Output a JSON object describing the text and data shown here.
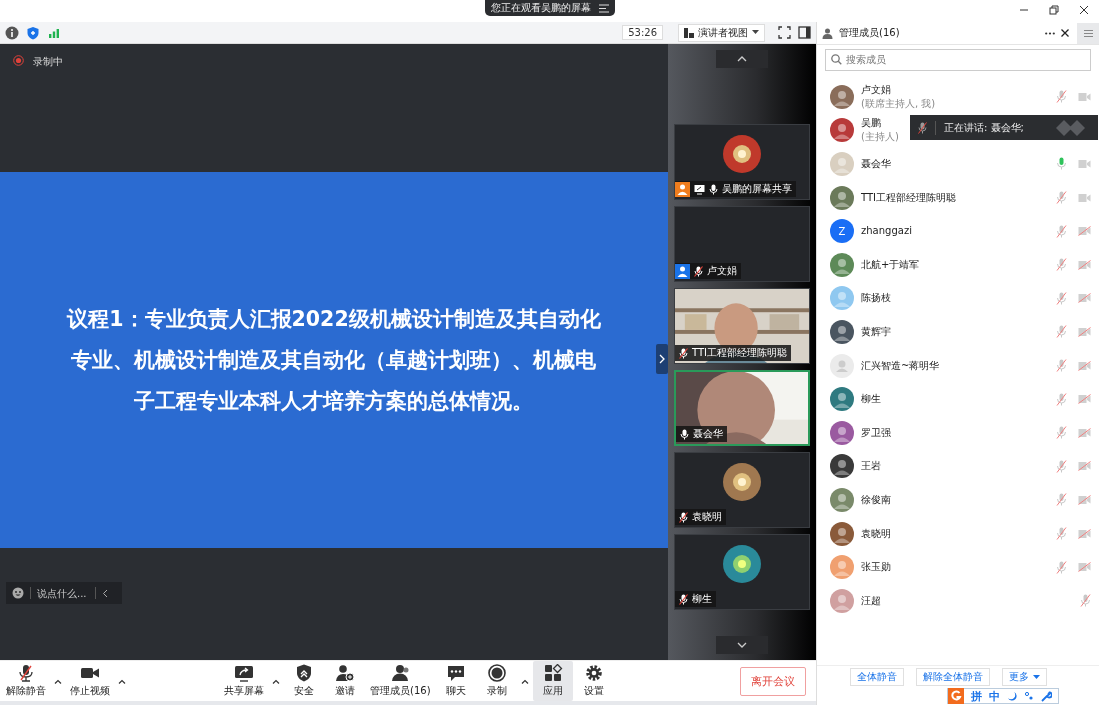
{
  "top_banner": {
    "text": "您正在观看吴鹏的屏幕"
  },
  "toolbar": {
    "timer": "53:26",
    "view_mode": "演讲者视图"
  },
  "recording": {
    "label": "录制中"
  },
  "slide": {
    "lines": [
      "议程1：专业负责人汇报2022级机械设计制造及其自动化",
      "专业、机械设计制造及其自动化（卓越计划班）、机械电",
      "子工程专业本科人才培养方案的总体情况。"
    ]
  },
  "chat_input": {
    "placeholder": "说点什么..."
  },
  "tiles": [
    {
      "name": "吴鹏的屏幕共享",
      "color": "#f07d1e",
      "sharing": true,
      "muted": false,
      "kind": "avatar",
      "speaking": false
    },
    {
      "name": "卢文娟",
      "color": "#1a73e8",
      "sharing": false,
      "muted": true,
      "kind": "empty",
      "speaking": false
    },
    {
      "name": "TTI工程部经理陈明聪",
      "sharing": false,
      "muted": true,
      "kind": "video",
      "speaking": false
    },
    {
      "name": "聂会华",
      "sharing": false,
      "muted": false,
      "kind": "video",
      "speaking": true
    },
    {
      "name": "袁晓明",
      "sharing": false,
      "muted": true,
      "kind": "avatar",
      "speaking": false
    },
    {
      "name": "柳生",
      "sharing": false,
      "muted": true,
      "kind": "avatar",
      "speaking": false
    }
  ],
  "bottom_toolbar": {
    "left_buttons": [
      {
        "kind": "mic",
        "label": "解除静音",
        "caret": true,
        "selected": false
      },
      {
        "kind": "camera",
        "label": "停止视频",
        "caret": true,
        "selected": false
      }
    ],
    "center_buttons": [
      {
        "kind": "share",
        "label": "共享屏幕",
        "caret": true,
        "selected": false
      },
      {
        "kind": "security",
        "label": "安全",
        "caret": false,
        "selected": false
      },
      {
        "kind": "invite",
        "label": "邀请",
        "caret": false,
        "selected": false
      },
      {
        "kind": "members",
        "label": "管理成员(16)",
        "caret": false,
        "selected": false
      },
      {
        "kind": "chat",
        "label": "聊天",
        "caret": false,
        "selected": false
      },
      {
        "kind": "record",
        "label": "录制",
        "caret": true,
        "selected": false
      },
      {
        "kind": "apps",
        "label": "应用",
        "caret": false,
        "selected": true
      },
      {
        "kind": "settings",
        "label": "设置",
        "caret": false,
        "selected": false
      }
    ],
    "leave": "离开会议"
  },
  "members_panel": {
    "title": "管理成员(16)",
    "search": {
      "placeholder": "搜索成员"
    },
    "members": [
      {
        "name": "卢文娟",
        "role": "(联席主持人, 我)",
        "mic_muted": true,
        "speaking": false,
        "camera_blocked": false
      },
      {
        "name": "吴鹏",
        "role": "(主持人)"
      },
      {
        "name": "聂会华",
        "mic_muted": false,
        "speaking": true,
        "camera_blocked": false
      },
      {
        "name": "TTI工程部经理陈明聪",
        "mic_muted": true,
        "speaking": false,
        "camera_blocked": false
      },
      {
        "name": "zhanggazi",
        "kind": "letter",
        "letter": "Z",
        "mic_muted": true,
        "speaking": false,
        "camera_blocked": true
      },
      {
        "name": "北航+于靖军",
        "mic_muted": true,
        "speaking": false,
        "camera_blocked": true
      },
      {
        "name": "陈扬枝",
        "mic_muted": true,
        "speaking": false,
        "camera_blocked": true
      },
      {
        "name": "黄辉宇",
        "mic_muted": true,
        "speaking": false,
        "camera_blocked": true
      },
      {
        "name": "汇兴智造~蒋明华",
        "kind": "default",
        "mic_muted": true,
        "speaking": false,
        "camera_blocked": true
      },
      {
        "name": "柳生",
        "mic_muted": true,
        "speaking": false,
        "camera_blocked": true
      },
      {
        "name": "罗卫强",
        "mic_muted": true,
        "speaking": false,
        "camera_blocked": true
      },
      {
        "name": "王岩",
        "mic_muted": true,
        "speaking": false,
        "camera_blocked": true
      },
      {
        "name": "徐俊南",
        "mic_muted": true,
        "speaking": false,
        "camera_blocked": true
      },
      {
        "name": "袁晓明",
        "mic_muted": true,
        "speaking": false,
        "camera_blocked": true
      },
      {
        "name": "张玉勋",
        "mic_muted": true,
        "speaking": false,
        "camera_blocked": true
      },
      {
        "name": "汪超",
        "mic_muted": true,
        "speaking": false
      }
    ],
    "speaking_tooltip": "正在讲话: 聂会华;",
    "buttons": [
      "全体静音",
      "解除全体静音"
    ],
    "more": "更多"
  },
  "ime_bar": {
    "labels": [
      "拼",
      "中"
    ]
  }
}
